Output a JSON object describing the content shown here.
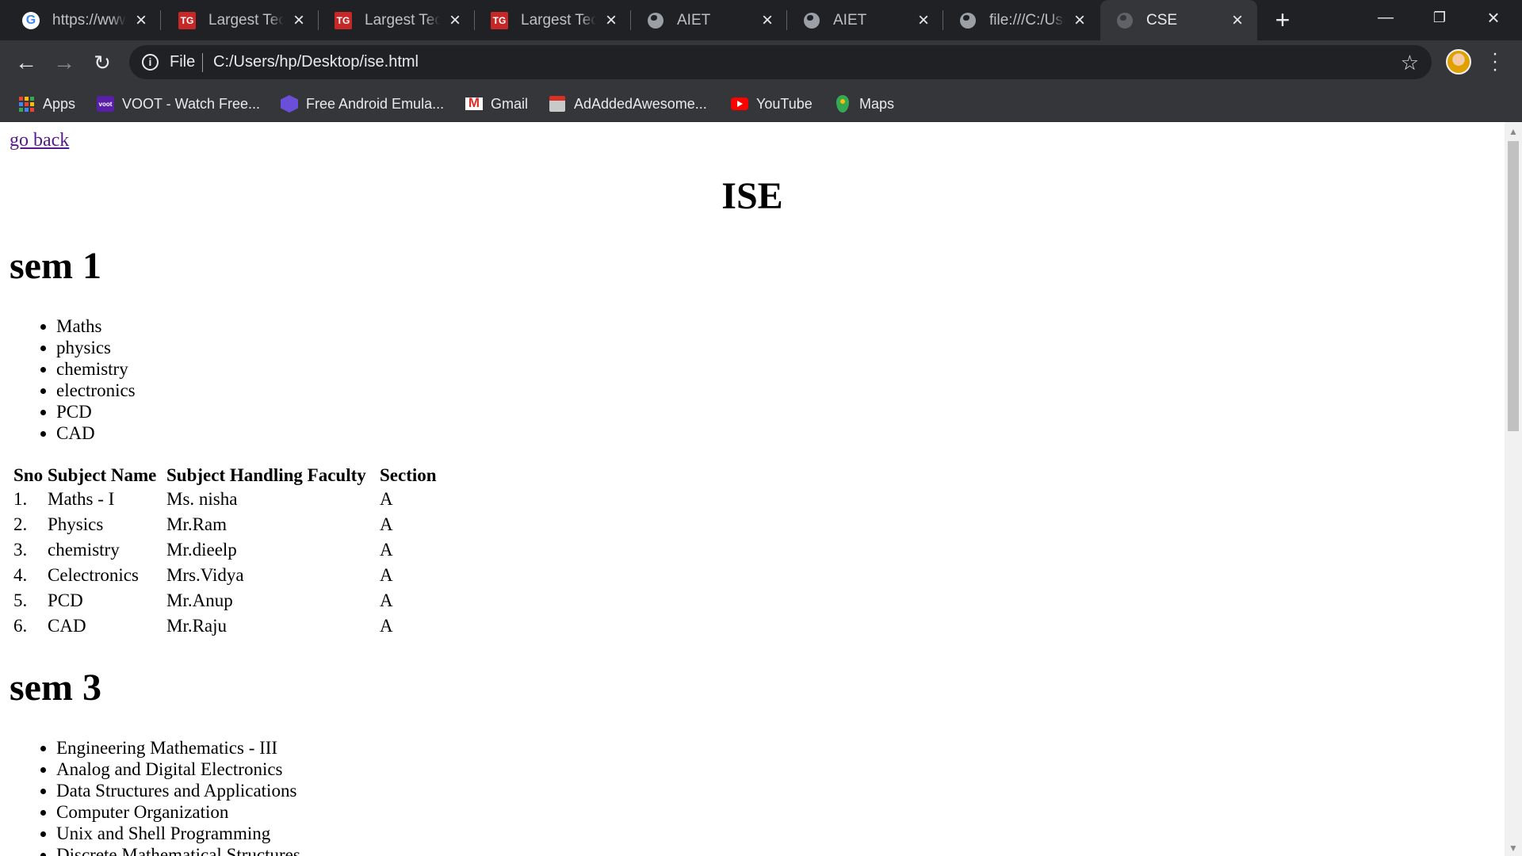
{
  "browser": {
    "tabs": [
      {
        "title": "https://www.",
        "icon": "google-icon"
      },
      {
        "title": "Largest Tech",
        "icon": "tg-icon"
      },
      {
        "title": "Largest Tech",
        "icon": "tg-icon"
      },
      {
        "title": "Largest Tech",
        "icon": "tg-icon"
      },
      {
        "title": "AIET",
        "icon": "globe-icon"
      },
      {
        "title": "AIET",
        "icon": "globe-icon"
      },
      {
        "title": "file:///C:/Use",
        "icon": "globe-icon"
      },
      {
        "title": "CSE",
        "icon": "globe-icon"
      }
    ],
    "active_tab": 7,
    "address": {
      "scheme_label": "File",
      "url": "C:/Users/hp/Desktop/ise.html"
    },
    "bookmarks": [
      {
        "label": "Apps",
        "icon": "apps-grid-icon"
      },
      {
        "label": "VOOT - Watch Free...",
        "icon": "voot-icon"
      },
      {
        "label": "Free Android Emula...",
        "icon": "emulator-icon"
      },
      {
        "label": "Gmail",
        "icon": "gmail-icon"
      },
      {
        "label": "AdAddedAwesome...",
        "icon": "adadded-icon"
      },
      {
        "label": "YouTube",
        "icon": "youtube-icon"
      },
      {
        "label": "Maps",
        "icon": "maps-icon"
      }
    ],
    "colors": {
      "frame": "#202124",
      "toolbar": "#35363a",
      "link_visited": "#551a8b"
    }
  },
  "page": {
    "back_link": "go back",
    "title": "ISE",
    "sem1": {
      "heading": "sem 1",
      "subjects": [
        "Maths",
        "physics",
        "chemistry",
        "electronics",
        "PCD",
        "CAD"
      ],
      "table": {
        "headers": [
          "Sno",
          "Subject Name",
          "Subject Handling Faculty",
          "Section"
        ],
        "rows": [
          [
            "1.",
            "Maths - I",
            "Ms. nisha",
            "A"
          ],
          [
            "2.",
            "Physics",
            "Mr.Ram",
            "A"
          ],
          [
            "3.",
            "chemistry",
            "Mr.dieelp",
            "A"
          ],
          [
            "4.",
            "Celectronics",
            "Mrs.Vidya",
            "A"
          ],
          [
            "5.",
            "PCD",
            "Mr.Anup",
            "A"
          ],
          [
            "6.",
            "CAD",
            "Mr.Raju",
            "A"
          ]
        ]
      }
    },
    "sem3": {
      "heading": "sem 3",
      "subjects": [
        "Engineering Mathematics - III",
        "Analog and Digital Electronics",
        "Data Structures and Applications",
        "Computer Organization",
        "Unix and Shell Programming",
        "Discrete Mathematical Structures"
      ]
    }
  }
}
